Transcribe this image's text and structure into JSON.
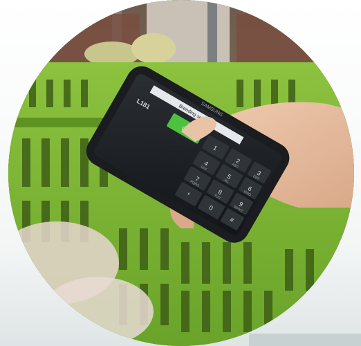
{
  "photo": {
    "subject": "hand holding smartphone over green plastic crate",
    "phone": {
      "brand": "SAMSUNG",
      "screen_header": "Breeding selection",
      "screen_code": "L181",
      "ok_button": "Ok",
      "keypad_keys": [
        "1",
        "2",
        "3",
        "4",
        "5",
        "6",
        "7",
        "8",
        "9",
        "*",
        "0",
        "#"
      ],
      "keypad_letters": [
        "ABC",
        "DEF",
        "GHI",
        "JKL",
        "MNO",
        "PQRS",
        "TUV",
        "WXYZ"
      ]
    },
    "colors": {
      "crate_green": "#79b234",
      "screen_dark": "#1c1f22",
      "ok_green": "#4cc23f",
      "skin": "#e7c1a4"
    }
  }
}
